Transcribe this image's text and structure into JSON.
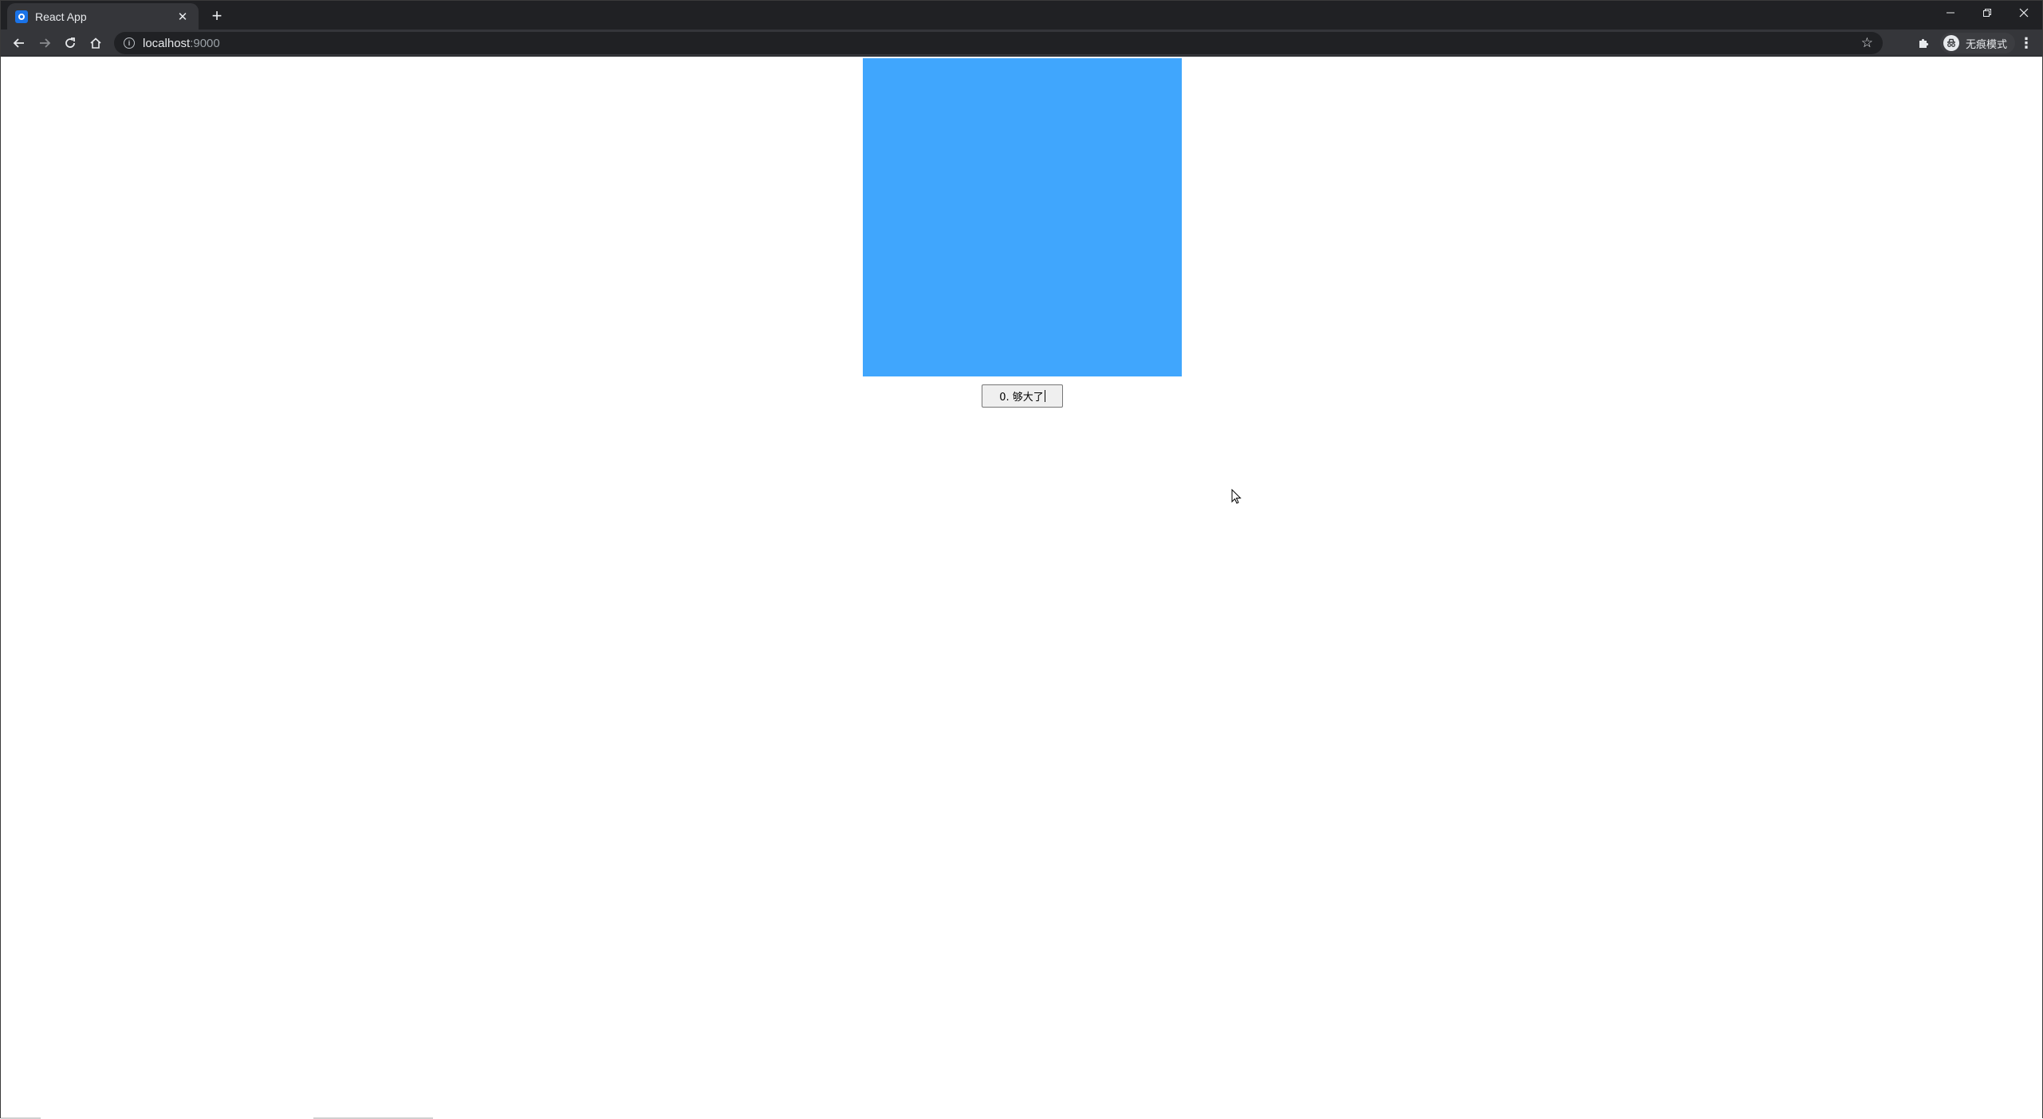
{
  "browser": {
    "tab": {
      "title": "React App",
      "favicon": "react-app-icon"
    },
    "new_tab_label": "+",
    "window_controls": {
      "minimize": "—",
      "restore": "❐",
      "close": "✕"
    },
    "address": {
      "host": "localhost",
      "port": ":9000"
    },
    "profile_label": "无痕模式",
    "icons": [
      "back-arrow-icon",
      "forward-arrow-icon",
      "reload-icon",
      "home-icon",
      "info-icon",
      "star-icon",
      "extensions-icon",
      "incognito-icon",
      "more-menu-icon"
    ]
  },
  "page": {
    "box_color": "#40a6fd",
    "button_label": "0. 够大了"
  }
}
